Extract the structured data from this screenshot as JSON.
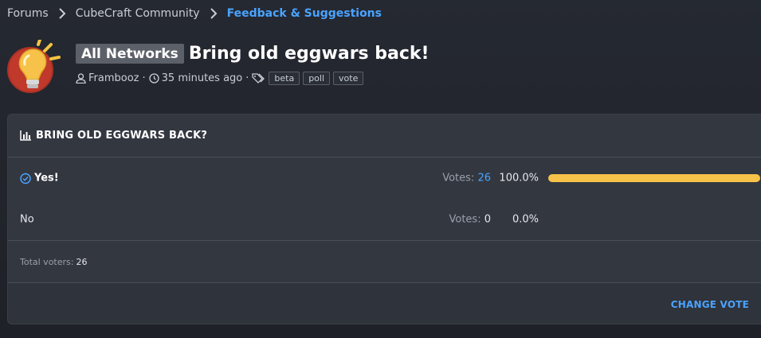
{
  "breadcrumb": [
    "Forums",
    "CubeCraft Community",
    "Feedback & Suggestions"
  ],
  "thread": {
    "prefix": "All Networks",
    "title": "Bring old eggwars back!",
    "author": "Frambooz",
    "time": "35 minutes ago",
    "tags": [
      "beta",
      "poll",
      "vote"
    ]
  },
  "poll": {
    "question": "BRING OLD EGGWARS BACK?",
    "options": [
      {
        "label": "Yes!",
        "votes_label": "Votes:",
        "votes": "26",
        "percent": "100.0%",
        "fill": 100
      },
      {
        "label": "No",
        "votes_label": "Votes:",
        "votes": "0",
        "percent": "0.0%",
        "fill": 0
      }
    ],
    "total_label": "Total voters:",
    "total": "26",
    "change_vote": "CHANGE VOTE"
  },
  "colors": {
    "accent": "#4aa3ff",
    "bar": "#f7c24a",
    "card": "#333740"
  },
  "icons": {
    "avatar": "lightbulb-icon",
    "poll": "bar-chart-icon",
    "author": "user-icon",
    "time": "clock-icon",
    "tags": "tags-icon",
    "voted": "check-circle-icon"
  }
}
